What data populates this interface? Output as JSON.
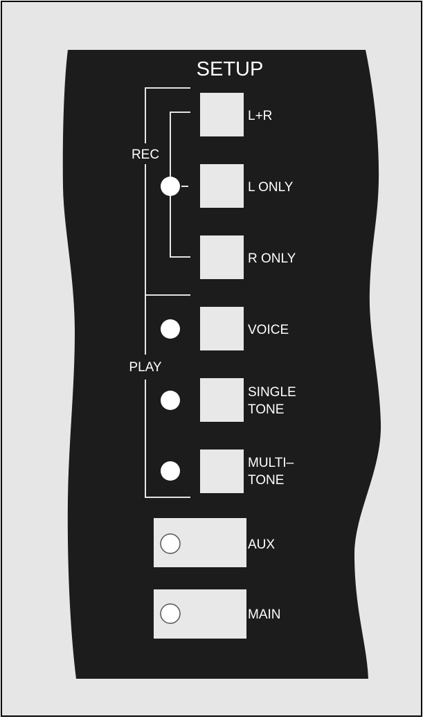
{
  "panel": {
    "title": "SETUP",
    "groups": {
      "rec": "REC",
      "play": "PLAY"
    },
    "rec_buttons": [
      {
        "label": "L+R"
      },
      {
        "label": "L ONLY"
      },
      {
        "label": "R ONLY"
      }
    ],
    "play_buttons": [
      {
        "label": "VOICE"
      },
      {
        "label_lines": [
          "SINGLE",
          "TONE"
        ]
      },
      {
        "label_lines": [
          "MULTI–",
          "TONE"
        ]
      }
    ],
    "output_buttons": [
      {
        "label": "AUX"
      },
      {
        "label": "MAIN"
      }
    ]
  },
  "colors": {
    "background": "#e6e6e6",
    "panel": "#1c1c1c",
    "button": "#e8e8e8",
    "text": "#ffffff"
  }
}
